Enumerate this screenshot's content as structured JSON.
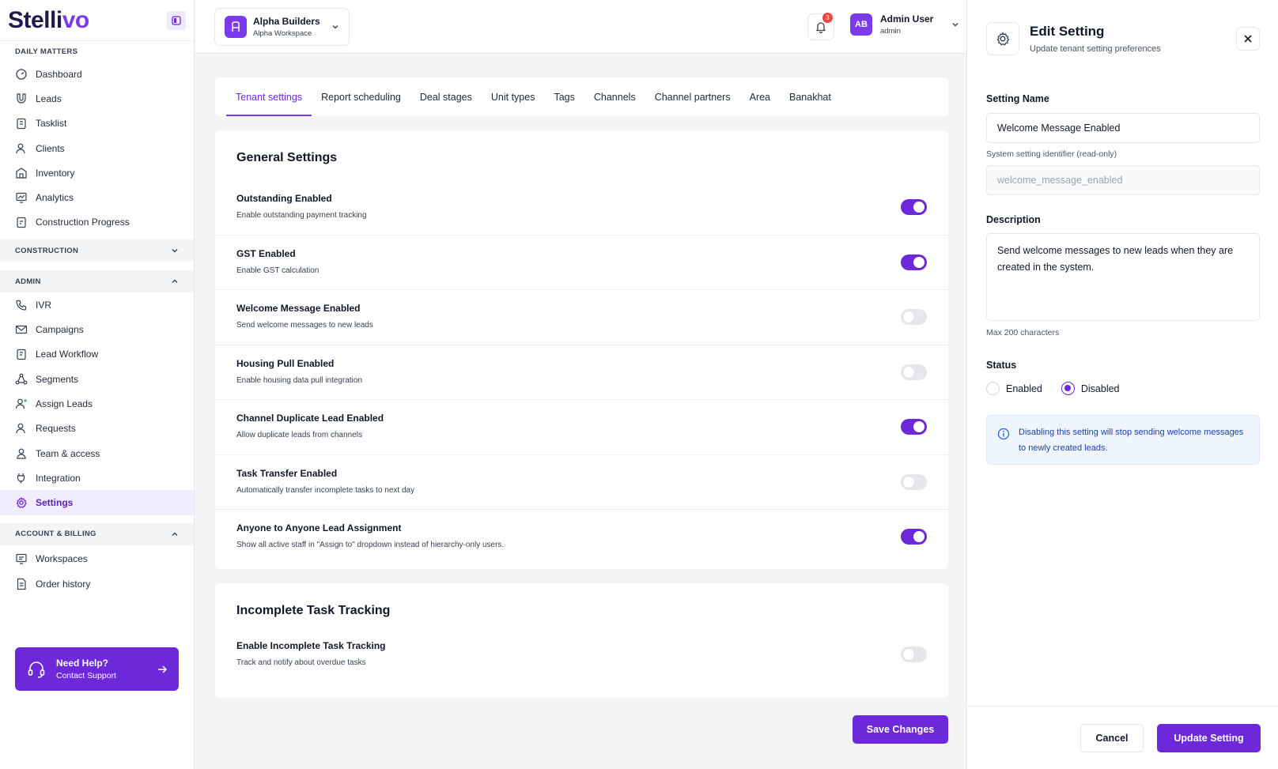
{
  "brand": {
    "logo_main": "Stelli",
    "logo_accent": "vo"
  },
  "sidebar": {
    "daily_label": "DAILY MATTERS",
    "daily_items": [
      {
        "label": "Dashboard",
        "icon": "dashboard-icon"
      },
      {
        "label": "Leads",
        "icon": "magnet-icon"
      },
      {
        "label": "Tasklist",
        "icon": "clipboard-icon"
      },
      {
        "label": "Clients",
        "icon": "person-icon"
      },
      {
        "label": "Inventory",
        "icon": "building-icon"
      },
      {
        "label": "Analytics",
        "icon": "monitor-chart-icon"
      },
      {
        "label": "Construction Progress",
        "icon": "clipboard-progress-icon"
      }
    ],
    "construction_label": "CONSTRUCTION",
    "admin_label": "ADMIN",
    "admin_items": [
      {
        "label": "IVR",
        "icon": "phone-icon"
      },
      {
        "label": "Campaigns",
        "icon": "mail-icon"
      },
      {
        "label": "Lead Workflow",
        "icon": "workflow-icon"
      },
      {
        "label": "Segments",
        "icon": "segments-icon"
      },
      {
        "label": "Assign Leads",
        "icon": "assign-user-icon"
      },
      {
        "label": "Requests",
        "icon": "person-request-icon"
      },
      {
        "label": "Team & access",
        "icon": "team-icon"
      },
      {
        "label": "Integration",
        "icon": "plug-icon"
      },
      {
        "label": "Settings",
        "icon": "gear-icon",
        "active": true
      }
    ],
    "billing_label": "ACCOUNT & BILLING",
    "billing_items": [
      {
        "label": "Workspaces",
        "icon": "workspace-icon"
      },
      {
        "label": "Order history",
        "icon": "document-icon"
      }
    ],
    "help": {
      "title": "Need Help?",
      "subtitle": "Contact Support"
    }
  },
  "topbar": {
    "workspace_name": "Alpha Builders",
    "workspace_sub": "Alpha Workspace",
    "notification_count": "3",
    "user_initials": "AB",
    "user_name": "Admin User",
    "user_role": "admin"
  },
  "tabs": [
    "Tenant settings",
    "Report scheduling",
    "Deal stages",
    "Unit types",
    "Tags",
    "Channels",
    "Channel partners",
    "Area",
    "Banakhat"
  ],
  "active_tab": "Tenant settings",
  "general": {
    "title": "General Settings",
    "items": [
      {
        "name": "Outstanding Enabled",
        "desc": "Enable outstanding payment tracking",
        "on": true
      },
      {
        "name": "GST Enabled",
        "desc": "Enable GST calculation",
        "on": true
      },
      {
        "name": "Welcome Message Enabled",
        "desc": "Send welcome messages to new leads",
        "on": false
      },
      {
        "name": "Housing Pull Enabled",
        "desc": "Enable housing data pull integration",
        "on": false
      },
      {
        "name": "Channel Duplicate Lead Enabled",
        "desc": "Allow duplicate leads from channels",
        "on": true
      },
      {
        "name": "Task Transfer Enabled",
        "desc": "Automatically transfer incomplete tasks to next day",
        "on": false
      },
      {
        "name": "Anyone to Anyone Lead Assignment",
        "desc": "Show all active staff in \"Assign to\" dropdown instead of hierarchy-only users.",
        "on": true
      }
    ]
  },
  "incomplete": {
    "title": "Incomplete Task Tracking",
    "items": [
      {
        "name": "Enable Incomplete Task Tracking",
        "desc": "Track and notify about overdue tasks",
        "on": false
      }
    ]
  },
  "save_label": "Save Changes",
  "panel": {
    "title": "Edit Setting",
    "subtitle": "Update tenant setting preferences",
    "name_label": "Setting Name",
    "name_value": "Welcome Message Enabled",
    "identifier_help": "System setting identifier (read-only)",
    "identifier_value": "welcome_message_enabled",
    "desc_label": "Description",
    "desc_value": "Send welcome messages to new leads when they are created in the system.",
    "desc_help": "Max 200 characters",
    "status_label": "Status",
    "status_options": [
      "Enabled",
      "Disabled"
    ],
    "status_selected": "Disabled",
    "info_text": "Disabling this setting will stop sending welcome messages to newly created leads.",
    "cancel_label": "Cancel",
    "update_label": "Update Setting"
  },
  "colors": {
    "accent": "#6d28d9",
    "info_bg": "#eff6ff",
    "info_text": "#1e40af"
  }
}
